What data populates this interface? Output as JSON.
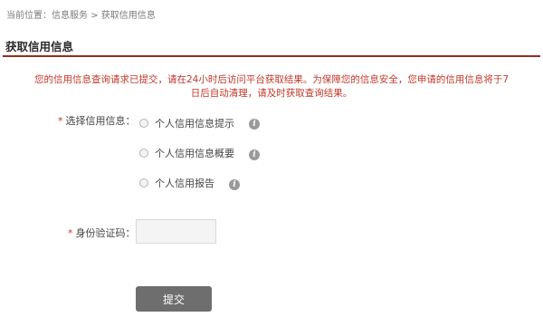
{
  "breadcrumb": {
    "label": "当前位置：",
    "items": [
      "信息服务",
      "获取信用信息"
    ],
    "separator": ">"
  },
  "page": {
    "title": "获取信用信息"
  },
  "notice": {
    "line1": "您的信用信息查询请求已提交，请在24小时后访问平台获取结果。为保障您的信息安全，您申请的信用信息将于7",
    "line2": "日后自动清理，请及时获取查询结果。"
  },
  "form": {
    "required_mark": "*",
    "select_label": "选择信用信息：",
    "options": [
      {
        "label": "个人信用信息提示",
        "selected": false,
        "info_icon": "info-icon"
      },
      {
        "label": "个人信用信息概要",
        "selected": false,
        "info_icon": "info-icon"
      },
      {
        "label": "个人信用报告",
        "selected": false,
        "info_icon": "info-icon"
      }
    ],
    "id_label": "身份验证码：",
    "id_value": "",
    "submit_label": "提交"
  },
  "colors": {
    "accent": "#8f2f1f",
    "notice": "#c0392b",
    "button": "#6e6e6e"
  }
}
